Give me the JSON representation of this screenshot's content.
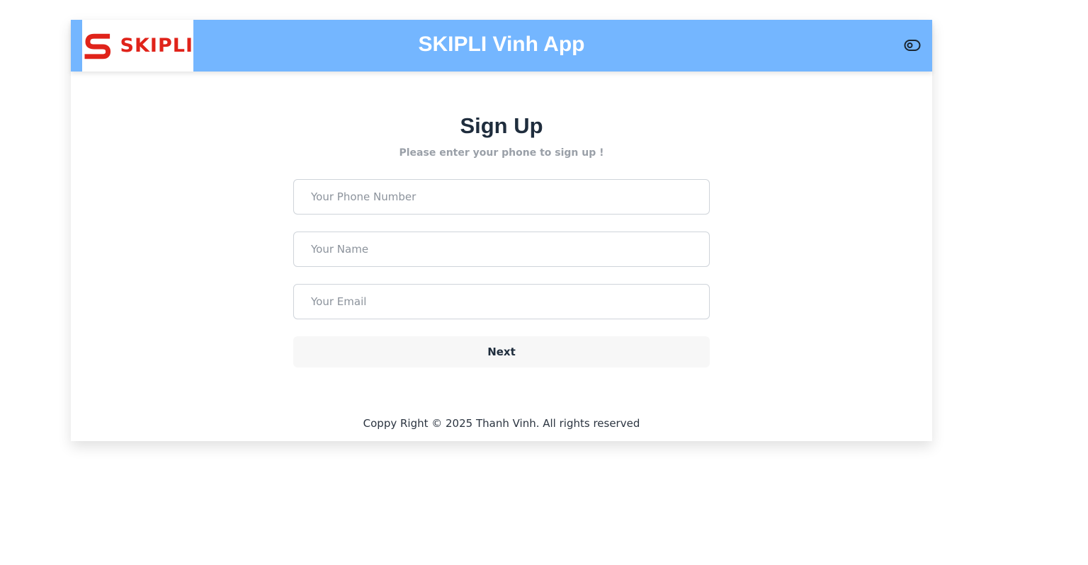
{
  "header": {
    "logo_text": "SKIPLI",
    "app_title": "SKIPLI Vinh App",
    "toggle_icon": "toggle-icon"
  },
  "form": {
    "title": "Sign Up",
    "subtitle": "Please enter your phone to sign up !",
    "phone_placeholder": "Your Phone Number",
    "name_placeholder": "Your Name",
    "email_placeholder": "Your Email",
    "next_label": "Next"
  },
  "footer": {
    "copyright": "Coppy Right © 2025 Thanh Vinh. All rights reserved"
  },
  "colors": {
    "header_bg": "#74b6ff",
    "brand_red": "#e0231a",
    "title_text": "#1f2d3d"
  }
}
